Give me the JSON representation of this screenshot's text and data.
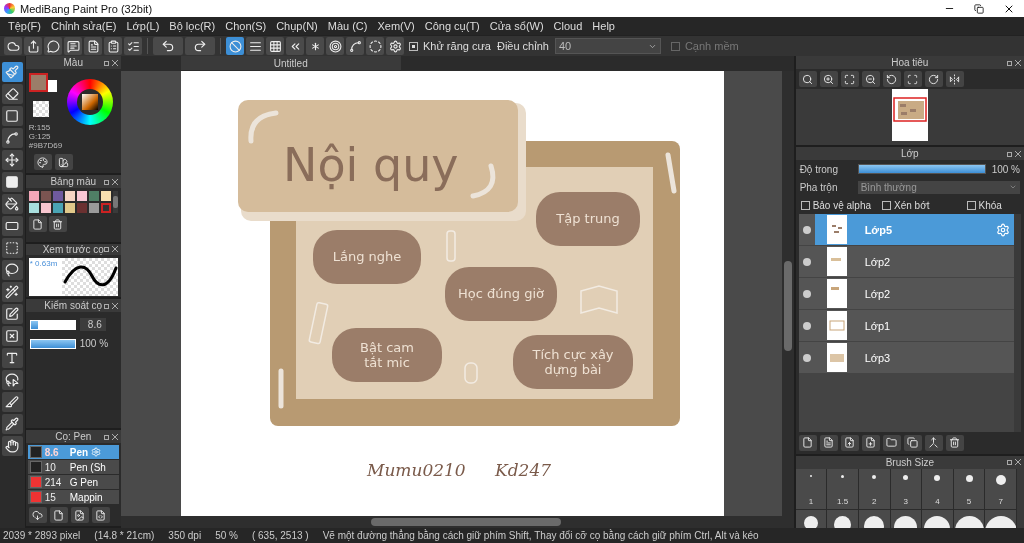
{
  "window": {
    "title": "MediBang Paint Pro (32bit)"
  },
  "menu": [
    "Tệp(F)",
    "Chỉnh sửa(E)",
    "Lớp(L)",
    "Bộ lọc(R)",
    "Chọn(S)",
    "Chụp(N)",
    "Màu (C)",
    "Xem(V)",
    "Công cụ(T)",
    "Cửa sổ(W)",
    "Cloud",
    "Help"
  ],
  "toolbar": {
    "snap_modes": [
      {
        "selected": true
      },
      {
        "selected": false
      },
      {
        "selected": false
      },
      {
        "selected": false
      },
      {
        "selected": false
      },
      {
        "selected": false
      },
      {
        "selected": false
      },
      {
        "selected": false
      }
    ],
    "antialias": {
      "label": "Khử răng cưa",
      "checked": true
    },
    "correction": {
      "label": "Điều chỉnh",
      "value": "40"
    },
    "soft_edge": {
      "label": "Cạnh mềm",
      "checked": false,
      "disabled": true
    }
  },
  "tools": [
    {
      "selected": true
    },
    {
      "selected": false
    },
    {
      "selected": false
    },
    {
      "selected": false
    },
    {
      "selected": false
    },
    {
      "selected": false
    },
    {
      "selected": false
    },
    {
      "selected": false
    },
    {
      "selected": false
    },
    {
      "selected": false
    },
    {
      "selected": false
    },
    {
      "selected": false
    },
    {
      "selected": false
    },
    {
      "selected": false
    },
    {
      "selected": false
    },
    {
      "selected": false
    },
    {
      "selected": false
    },
    {
      "selected": false
    }
  ],
  "color_panel": {
    "title": "Màu",
    "r": "R:155",
    "g": "G:125",
    "hex": "#9B7D69"
  },
  "palette_panel": {
    "title": "Bảng màu",
    "swatches": [
      {
        "color": "#f4a7b9",
        "selected": false
      },
      {
        "color": "#7a5451",
        "selected": false
      },
      {
        "color": "#6f5a9e",
        "selected": false
      },
      {
        "color": "#f6d6c4",
        "selected": false
      },
      {
        "color": "#f8c8d4",
        "selected": false
      },
      {
        "color": "#4f7f65",
        "selected": false
      },
      {
        "color": "#f7dfb0",
        "selected": false
      },
      {
        "color": "#a8dedd",
        "selected": false
      },
      {
        "color": "#f8c6cf",
        "selected": false
      },
      {
        "color": "#4aa4b4",
        "selected": false
      },
      {
        "color": "#e1c98a",
        "selected": false
      },
      {
        "color": "#6a3030",
        "selected": false
      },
      {
        "color": "#9a9a9a",
        "selected": false
      },
      {
        "color": "#333333",
        "selected": true
      }
    ]
  },
  "brush_preview": {
    "title": "Xem trước cọ",
    "size": "* 0.63m"
  },
  "brush_control": {
    "title": "Kiểm soát cọ",
    "size": {
      "level": 0.17,
      "reading": "8.6"
    },
    "opacity": {
      "level": 1,
      "reading": "100 %"
    }
  },
  "brush_panel": {
    "title": "Cọ: Pen",
    "brushes": [
      {
        "color": "#222222",
        "size": "8.6",
        "name": "Pen",
        "selected": true
      },
      {
        "color": "#222222",
        "size": "10",
        "name": "Pen (Sh",
        "selected": false
      },
      {
        "color": "#ee3333",
        "size": "214",
        "name": "G Pen",
        "selected": false
      },
      {
        "color": "#ee3333",
        "size": "15",
        "name": "Mappin",
        "selected": false
      }
    ]
  },
  "document": {
    "tab": "Untitled",
    "title": "Nội quy",
    "notes": [
      {
        "lines": [
          "Tập trung"
        ]
      },
      {
        "lines": [
          "Lắng nghe"
        ]
      },
      {
        "lines": [
          "Học đúng giờ"
        ]
      },
      {
        "lines": [
          "Bật cam",
          "tắt mic"
        ]
      },
      {
        "lines": [
          "Tích cực xây",
          "dựng bài"
        ]
      }
    ],
    "signatures": [
      "Mumu0210",
      "Kd247"
    ]
  },
  "navigator": {
    "title": "Hoa tiêu"
  },
  "layers_panel": {
    "title": "Lớp",
    "opacity": {
      "label": "Độ trong",
      "level": 1,
      "reading": "100 %"
    },
    "blend": {
      "label": "Pha trộn",
      "value": "Bình thường"
    },
    "options": [
      {
        "label": "Bảo vệ alpha",
        "checked": false
      },
      {
        "label": "Xén bớt",
        "checked": false
      },
      {
        "label": "Khóa",
        "checked": false
      }
    ],
    "layers": [
      {
        "name": "Lớp5",
        "selected": true
      },
      {
        "name": "Lớp2",
        "selected": false
      },
      {
        "name": "Lớp2",
        "selected": false
      },
      {
        "name": "Lớp1",
        "selected": false
      },
      {
        "name": "Lớp3",
        "selected": false
      }
    ]
  },
  "brush_size_panel": {
    "title": "Brush Size",
    "sizes": [
      "1",
      "1.5",
      "2",
      "3",
      "4",
      "5",
      "7"
    ]
  },
  "status_bar": [
    "2039 * 2893 pixel",
    "(14.8 * 21cm)",
    "350 dpi",
    "50 %",
    "( 635, 2513 )",
    "Vẽ một đường thẳng bằng cách giữ phím Shift, Thay đổi cỡ cọ bằng cách giữ phím Ctrl, Alt và kéo"
  ]
}
